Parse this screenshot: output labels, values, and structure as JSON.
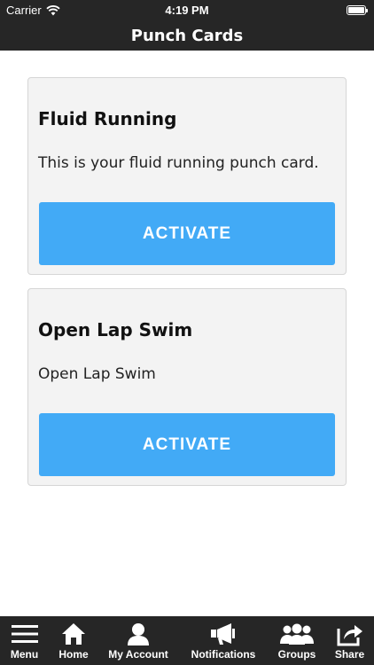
{
  "status_bar": {
    "carrier": "Carrier",
    "time": "4:19 PM",
    "wifi_icon": "wifi-icon",
    "battery_icon": "battery-icon",
    "battery_level": 1.0
  },
  "nav": {
    "title": "Punch Cards"
  },
  "cards": [
    {
      "title": "Fluid Running",
      "description": "This is your fluid running punch card.",
      "button_label": "ACTIVATE"
    },
    {
      "title": "Open Lap Swim",
      "description": "Open Lap Swim",
      "button_label": "ACTIVATE"
    }
  ],
  "tabs": [
    {
      "label": "Menu",
      "icon": "menu-icon"
    },
    {
      "label": "Home",
      "icon": "home-icon"
    },
    {
      "label": "My Account",
      "icon": "user-icon"
    },
    {
      "label": "Notifications",
      "icon": "megaphone-icon"
    },
    {
      "label": "Groups",
      "icon": "groups-icon"
    },
    {
      "label": "Share",
      "icon": "share-icon"
    }
  ],
  "colors": {
    "bars": "#262626",
    "card_background": "#f3f3f3",
    "button": "#42aaf6",
    "text_on_dark": "#ffffff"
  }
}
